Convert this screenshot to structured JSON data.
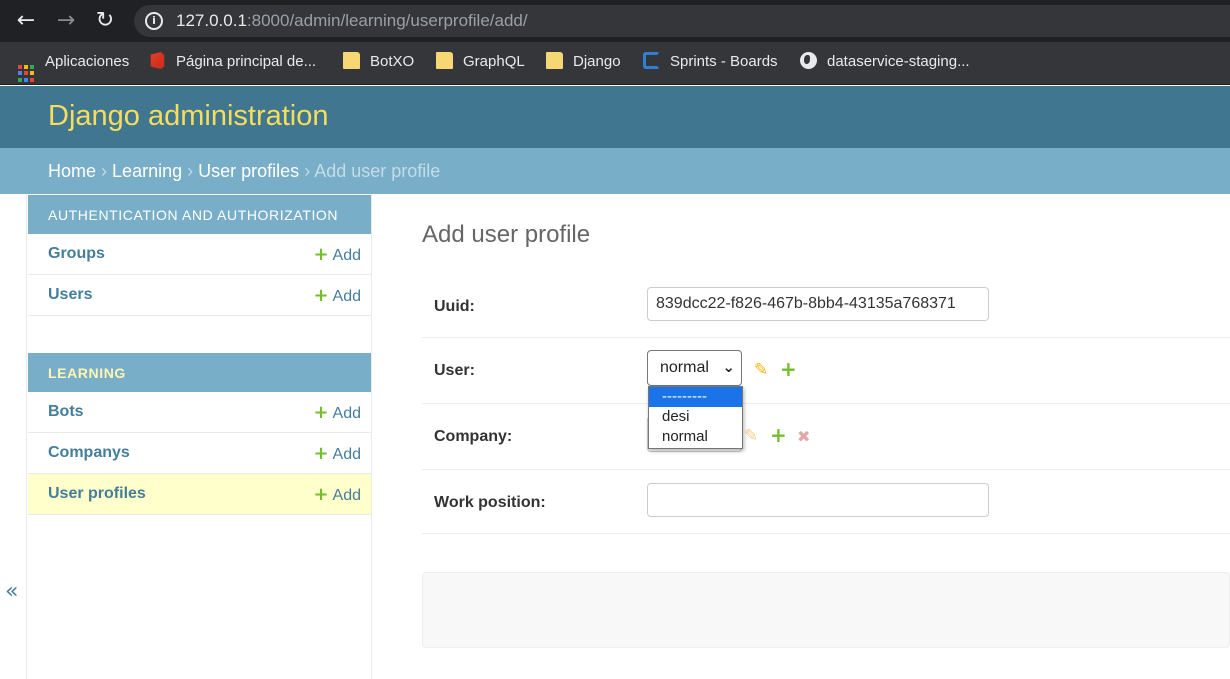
{
  "browser": {
    "url_host": "127.0.0.1",
    "url_rest": ":8000/admin/learning/userprofile/add/",
    "bookmarks": [
      {
        "label": "Aplicaciones",
        "icon": "apps-icon"
      },
      {
        "label": "Página principal de...",
        "icon": "office-icon"
      },
      {
        "label": "BotXO",
        "icon": "folder-icon"
      },
      {
        "label": "GraphQL",
        "icon": "folder-icon"
      },
      {
        "label": "Django",
        "icon": "folder-icon"
      },
      {
        "label": "Sprints - Boards",
        "icon": "azure-devops-icon"
      },
      {
        "label": "dataservice-staging...",
        "icon": "globe-icon"
      }
    ]
  },
  "header": {
    "branding": "Django administration"
  },
  "breadcrumbs": {
    "home": "Home",
    "app": "Learning",
    "model": "User profiles",
    "current": "Add user profile",
    "separator": "›"
  },
  "sidebar": {
    "modules": [
      {
        "caption": "AUTHENTICATION AND AUTHORIZATION",
        "rows": [
          {
            "label": "Groups",
            "add": "Add"
          },
          {
            "label": "Users",
            "add": "Add"
          }
        ]
      },
      {
        "caption": "LEARNING",
        "rows": [
          {
            "label": "Bots",
            "add": "Add"
          },
          {
            "label": "Companys",
            "add": "Add"
          },
          {
            "label": "User profiles",
            "add": "Add"
          }
        ]
      }
    ],
    "collapse_glyph": "«"
  },
  "content": {
    "title": "Add user profile",
    "fields": {
      "uuid": {
        "label": "Uuid:",
        "value": "839dcc22-f826-467b-8bb4-43135a768371"
      },
      "user": {
        "label": "User:",
        "selected": "normal",
        "options": [
          "---------",
          "desi",
          "normal"
        ]
      },
      "company": {
        "label": "Company:"
      },
      "work_position": {
        "label": "Work position:",
        "value": ""
      }
    }
  },
  "colors": {
    "header_bg": "#417690",
    "branding": "#f5dd5d",
    "breadcrumbs_bg": "#79aec8",
    "link": "#447e9b",
    "add_plus": "#70bf2b",
    "current_row": "#ffffcc"
  }
}
